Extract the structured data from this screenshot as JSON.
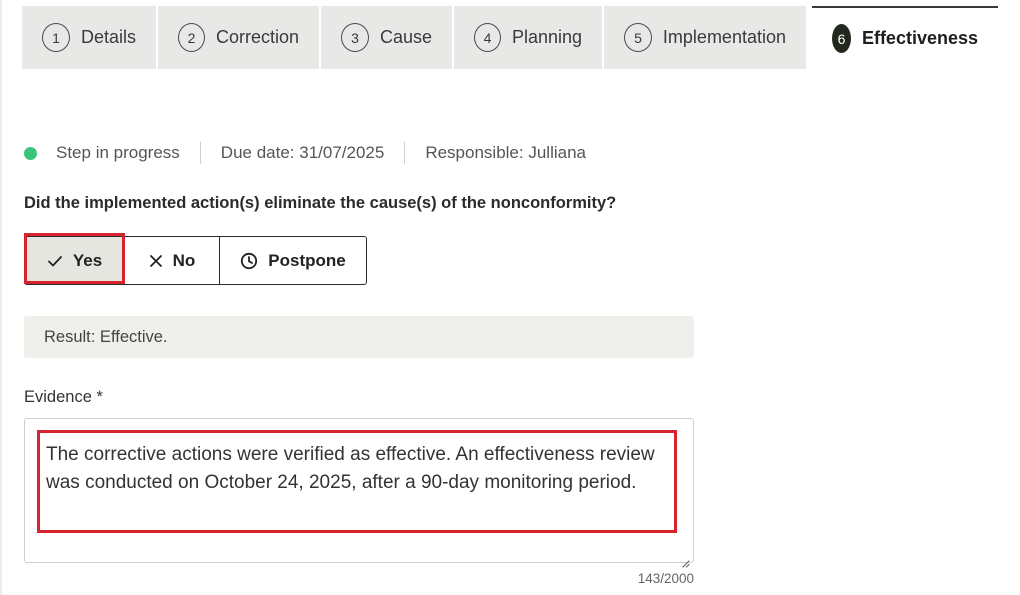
{
  "steps": [
    {
      "num": "1",
      "label": "Details"
    },
    {
      "num": "2",
      "label": "Correction"
    },
    {
      "num": "3",
      "label": "Cause"
    },
    {
      "num": "4",
      "label": "Planning"
    },
    {
      "num": "5",
      "label": "Implementation"
    },
    {
      "num": "6",
      "label": "Effectiveness"
    }
  ],
  "active_step": "6",
  "status": {
    "text": "Step in progress",
    "due_date": "Due date: 31/07/2025",
    "responsible": "Responsible: Julliana",
    "indicator_color": "#3cc47c"
  },
  "question": "Did the implemented action(s) eliminate the cause(s) of the nonconformity?",
  "choices": {
    "yes": "Yes",
    "no": "No",
    "postpone": "Postpone",
    "selected": "Yes"
  },
  "result": "Result: Effective.",
  "evidence": {
    "label": "Evidence *",
    "value": "The corrective actions were verified as effective. An effectiveness review was conducted on October 24, 2025, after a 90-day monitoring period.",
    "counter": "143/2000"
  },
  "colors": {
    "highlight": "#d6252c",
    "active_step_badge": "#23281f"
  }
}
